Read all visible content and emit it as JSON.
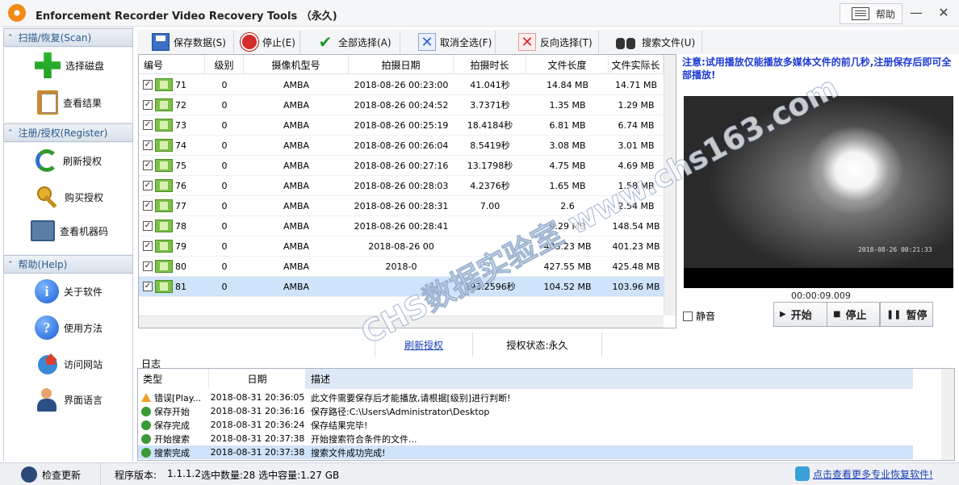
{
  "window": {
    "title": "Enforcement Recorder Video Recovery Tools （永久)",
    "help_label": "帮助",
    "minimize": "—",
    "close": "✕"
  },
  "sidebar": {
    "sections": [
      {
        "header": "扫描/恢复(Scan)",
        "items": [
          {
            "label": "选择磁盘",
            "icon": "add-disk-icon"
          },
          {
            "label": "查看结果",
            "icon": "clipboard-icon"
          }
        ]
      },
      {
        "header": "注册/授权(Register)",
        "items": [
          {
            "label": "刷新授权",
            "icon": "refresh-icon"
          },
          {
            "label": "购买授权",
            "icon": "key-icon"
          },
          {
            "label": "查看机器码",
            "icon": "machine-code-icon"
          }
        ]
      },
      {
        "header": "帮助(Help)",
        "items": [
          {
            "label": "关于软件",
            "icon": "info-icon"
          },
          {
            "label": "使用方法",
            "icon": "question-icon"
          },
          {
            "label": "访问网站",
            "icon": "home-globe-icon"
          },
          {
            "label": "界面语言",
            "icon": "user-language-icon"
          }
        ]
      }
    ]
  },
  "toolbar": {
    "save": "保存数据(S)",
    "stop": "停止(E)",
    "select_all": "全部选择(A)",
    "deselect_all": "取消全选(F)",
    "invert": "反向选择(T)",
    "search": "搜索文件(U)"
  },
  "file_table": {
    "columns": [
      "编号",
      "级别",
      "摄像机型号",
      "拍摄日期",
      "拍摄时长",
      "文件长度",
      "文件实际长"
    ],
    "rows": [
      {
        "id": "71",
        "level": "0",
        "model": "AMBA",
        "date": "2018-08-26 00:23:00",
        "duration": "41.041秒",
        "size": "14.84 MB",
        "actual": "14.71 MB"
      },
      {
        "id": "72",
        "level": "0",
        "model": "AMBA",
        "date": "2018-08-26 00:24:52",
        "duration": "3.7371秒",
        "size": "1.35 MB",
        "actual": "1.29 MB"
      },
      {
        "id": "73",
        "level": "0",
        "model": "AMBA",
        "date": "2018-08-26 00:25:19",
        "duration": "18.4184秒",
        "size": "6.81 MB",
        "actual": "6.74 MB"
      },
      {
        "id": "74",
        "level": "0",
        "model": "AMBA",
        "date": "2018-08-26 00:26:04",
        "duration": "8.5419秒",
        "size": "3.08 MB",
        "actual": "3.01 MB"
      },
      {
        "id": "75",
        "level": "0",
        "model": "AMBA",
        "date": "2018-08-26 00:27:16",
        "duration": "13.1798秒",
        "size": "4.75 MB",
        "actual": "4.69 MB"
      },
      {
        "id": "76",
        "level": "0",
        "model": "AMBA",
        "date": "2018-08-26 00:28:03",
        "duration": "4.2376秒",
        "size": "1.65 MB",
        "actual": "1.58 MB"
      },
      {
        "id": "77",
        "level": "0",
        "model": "AMBA",
        "date": "2018-08-26 00:28:31",
        "duration": "7.00",
        "size": "2.6",
        "actual": "2.54 MB"
      },
      {
        "id": "78",
        "level": "0",
        "model": "AMBA",
        "date": "2018-08-26 00:28:41",
        "duration": "",
        "size": "9.29 MB",
        "actual": "148.54 MB"
      },
      {
        "id": "79",
        "level": "0",
        "model": "AMBA",
        "date": "2018-08-26 00",
        "duration": "",
        "size": "403.23 MB",
        "actual": "401.23 MB"
      },
      {
        "id": "80",
        "level": "0",
        "model": "AMBA",
        "date": "2018-0",
        "duration": "",
        "size": "427.55 MB",
        "actual": "425.48 MB"
      },
      {
        "id": "81",
        "level": "0",
        "model": "AMBA",
        "date": "",
        "duration": "293.2596秒",
        "size": "104.52 MB",
        "actual": "103.96 MB"
      }
    ],
    "selected_row": "81"
  },
  "license_bar": {
    "refresh_link": "刷新授权",
    "status": "授权状态:永久"
  },
  "player": {
    "note": "注意:试用播放仅能播放多媒体文件的前几秒,注册保存后即可全部播放!",
    "timestamp_overlay": "2018-08-26 00:21:33",
    "time": "00:00:09.009",
    "mute_label": "静音",
    "play_label": "开始",
    "stop_label": "停止",
    "pause_label": "暂停"
  },
  "log": {
    "title": "日志",
    "columns": [
      "类型",
      "日期",
      "描述"
    ],
    "rows": [
      {
        "type": "错误[Play...",
        "icon": "warning-icon",
        "date": "2018-08-31 20:36:05",
        "desc": "此文件需要保存后才能播放,请根据[级别]进行判断!"
      },
      {
        "type": "保存开始",
        "icon": "info-green-icon",
        "date": "2018-08-31 20:36:16",
        "desc": "保存路径:C:\\Users\\Administrator\\Desktop"
      },
      {
        "type": "保存完成",
        "icon": "info-green-icon",
        "date": "2018-08-31 20:36:24",
        "desc": "保存结果完毕!"
      },
      {
        "type": "开始搜索",
        "icon": "info-green-icon",
        "date": "2018-08-31 20:37:38",
        "desc": "开始搜索符合条件的文件..."
      },
      {
        "type": "搜索完成",
        "icon": "info-green-icon",
        "date": "2018-08-31 20:37:38",
        "desc": "搜索文件成功完成!"
      }
    ]
  },
  "statusbar": {
    "update": "检查更新",
    "version_label": "程序版本:",
    "version": "1.1.1.2",
    "selection": "选中数量:28 选中容量:1.27 GB",
    "promo_link": "点击查看更多专业恢复软件!"
  },
  "watermark": "CHS数据实验室 www.chs163.com"
}
